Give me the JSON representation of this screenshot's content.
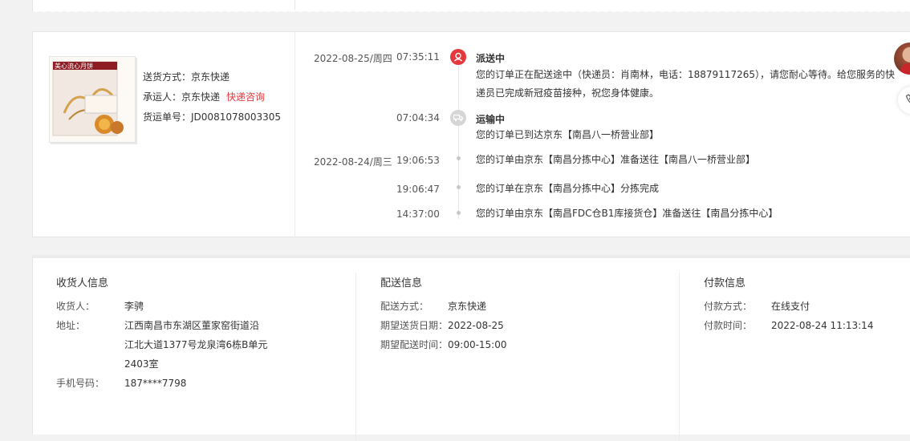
{
  "shipping": {
    "method_label": "送货方式：",
    "method_value": "京东快递",
    "carrier_label": "承运人：",
    "carrier_value": "京东快递",
    "consult_link": "快递咨询",
    "waybill_label": "货运单号：",
    "waybill_value": "JD0081078003305"
  },
  "product": {
    "box_text": "美心流心月饼"
  },
  "timeline": [
    {
      "date": "2022-08-25/周四",
      "time": "07:35:11",
      "status": "派送中",
      "text": [
        "您的订单正在配送途中（快递员：肖南林，电话：18879117265），请您耐心等待。给您服务的快",
        "递员已完成新冠疫苗接种，祝您身体健康。"
      ],
      "icon": "courier-icon"
    },
    {
      "date": "",
      "time": "07:04:34",
      "status": "运输中",
      "text": [
        "您的订单已到达京东【南昌八一桥营业部】"
      ],
      "icon": "truck-icon"
    },
    {
      "date": "2022-08-24/周三",
      "time": "19:06:53",
      "status": "",
      "text": [
        "您的订单由京东【南昌分拣中心】准备送往【南昌八一桥营业部】"
      ]
    },
    {
      "date": "",
      "time": "19:06:47",
      "status": "",
      "text": [
        "您的订单在京东【南昌分拣中心】分拣完成"
      ]
    },
    {
      "date": "",
      "time": "14:37:00",
      "status": "",
      "text": [
        "您的订单由京东【南昌FDC仓B1库接货仓】准备送往【南昌分拣中心】"
      ]
    }
  ],
  "receiver": {
    "title": "收货人信息",
    "name_label": "收货人：",
    "name_value": "李骋",
    "address_label": "地址：",
    "address_lines": [
      "江西南昌市东湖区董家窑街道沿",
      "江北大道1377号龙泉湾6栋B单元",
      "2403室"
    ],
    "phone_label": "手机号码：",
    "phone_value": "187****7798"
  },
  "delivery": {
    "title": "配送信息",
    "method_label": "配送方式：",
    "method_value": "京东快递",
    "date_label": "期望送货日期：",
    "date_value": "2022-08-25",
    "time_label": "期望配送时间：",
    "time_value": "09:00-15:00"
  },
  "payment": {
    "title": "付款信息",
    "method_label": "付款方式：",
    "method_value": "在线支付",
    "time_label": "付款时间：",
    "time_value": "2022-08-24 11:13:14"
  },
  "colors": {
    "accent": "#e4393c",
    "text": "#333333",
    "muted": "#555555",
    "border": "#e6e6e6",
    "background": "#f2f2f2"
  }
}
